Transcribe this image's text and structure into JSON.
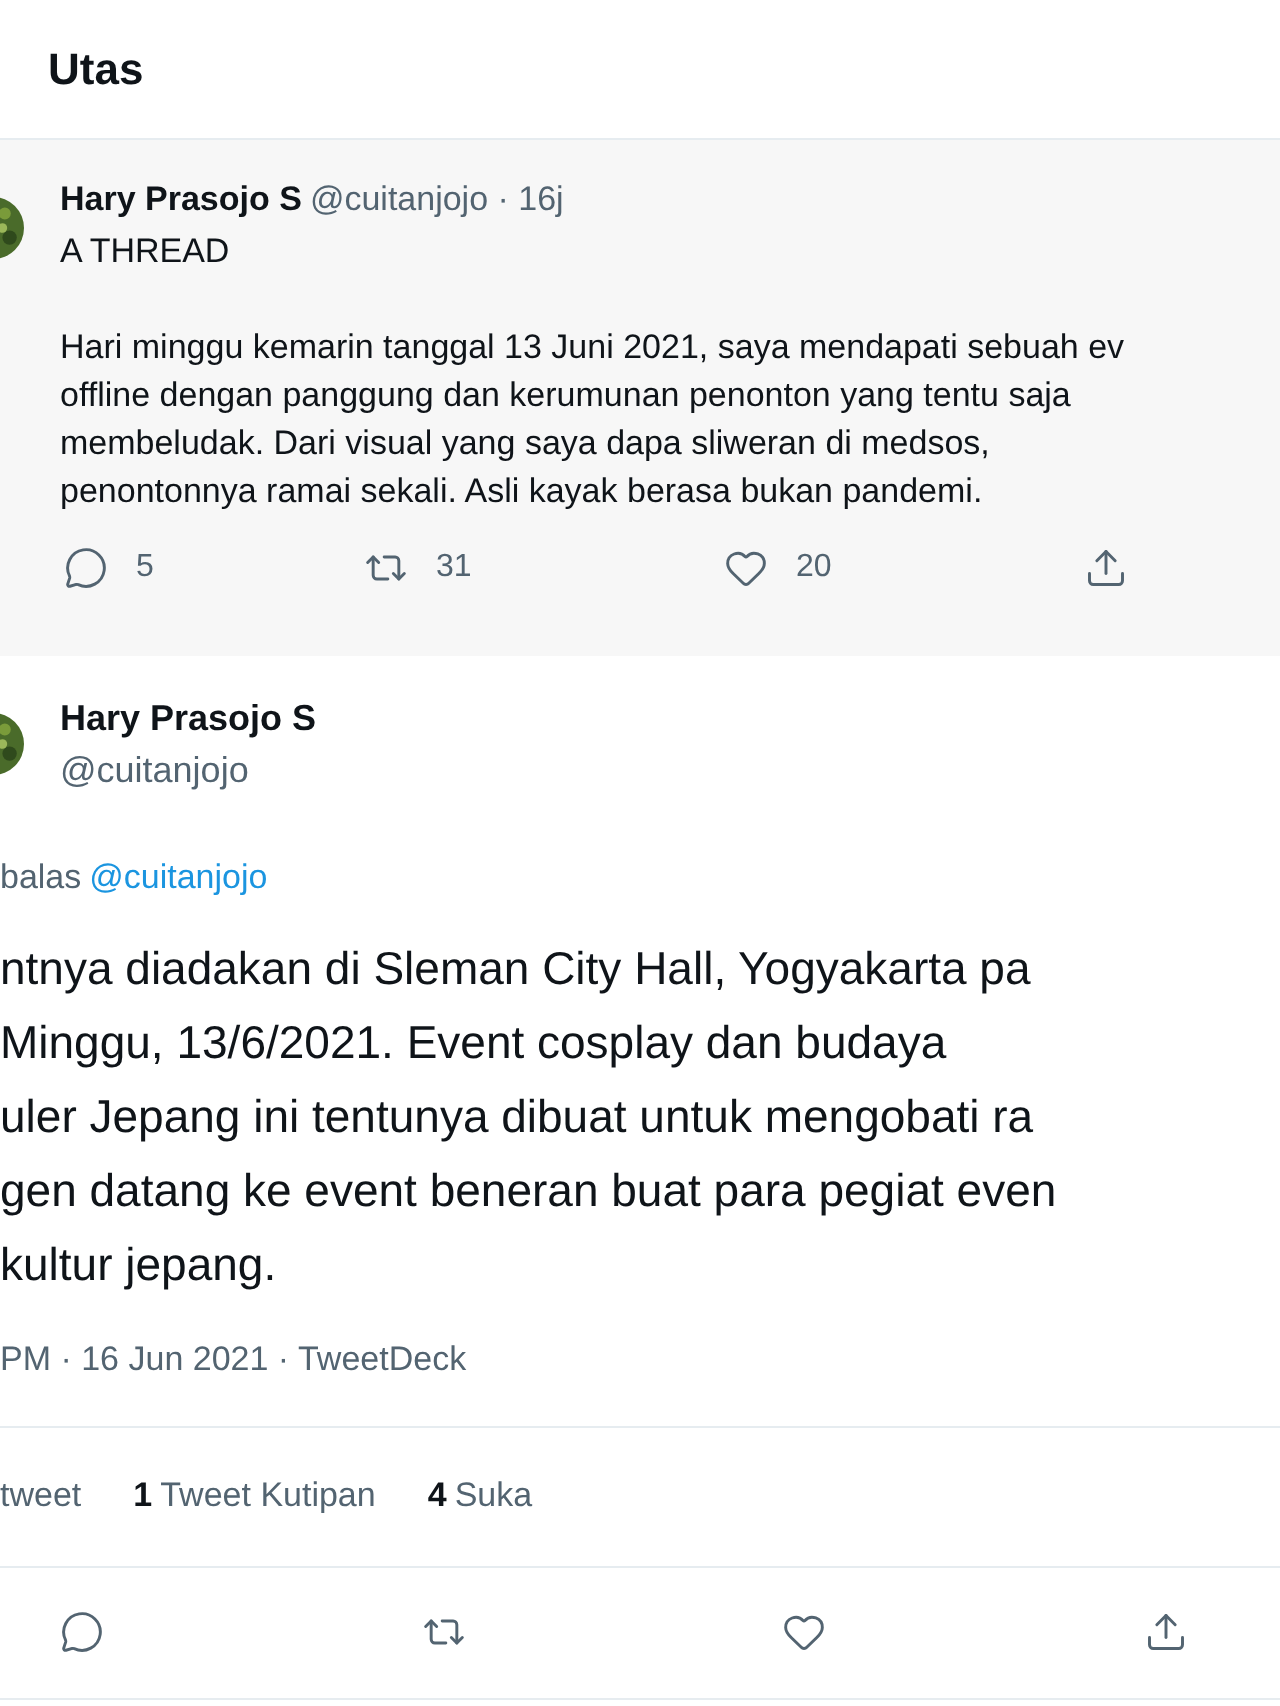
{
  "header": {
    "title": "Utas"
  },
  "parent_tweet": {
    "name": "Hary Prasojo S",
    "handle": "@cuitanjojo · 16j",
    "intro": "A THREAD",
    "lines": [
      "Hari minggu kemarin tanggal 13 Juni 2021, saya mendapati sebuah ev",
      "offline dengan panggung dan kerumunan penonton yang tentu saja",
      "membeludak. Dari visual yang saya dapa sliweran di medsos,",
      "penontonnya ramai sekali. Asli kayak berasa bukan pandemi."
    ],
    "actions": [
      {
        "kind": "reply",
        "count": "5"
      },
      {
        "kind": "retweet",
        "count": "31"
      },
      {
        "kind": "like",
        "count": "20"
      },
      {
        "kind": "share"
      }
    ]
  },
  "main_tweet": {
    "name": "Hary Prasojo S",
    "handle": "@cuitanjojo",
    "reply_prefix": "balas",
    "reply_to": "@cuitanjojo",
    "lines": [
      "ntnya diadakan di Sleman City Hall, Yogyakarta pa",
      "Minggu, 13/6/2021. Event cosplay dan budaya",
      "uler Jepang ini tentunya dibuat untuk mengobati ra",
      "gen datang ke event beneran buat para pegiat even",
      "kultur jepang."
    ],
    "meta": "PM · 16 Jun 2021 · TweetDeck",
    "stats": [
      {
        "label": "tweet"
      },
      {
        "count": "1",
        "label": "Tweet Kutipan"
      },
      {
        "count": "4",
        "label": "Suka"
      }
    ],
    "actions": [
      {
        "kind": "reply"
      },
      {
        "kind": "retweet"
      },
      {
        "kind": "like"
      },
      {
        "kind": "share"
      }
    ]
  }
}
